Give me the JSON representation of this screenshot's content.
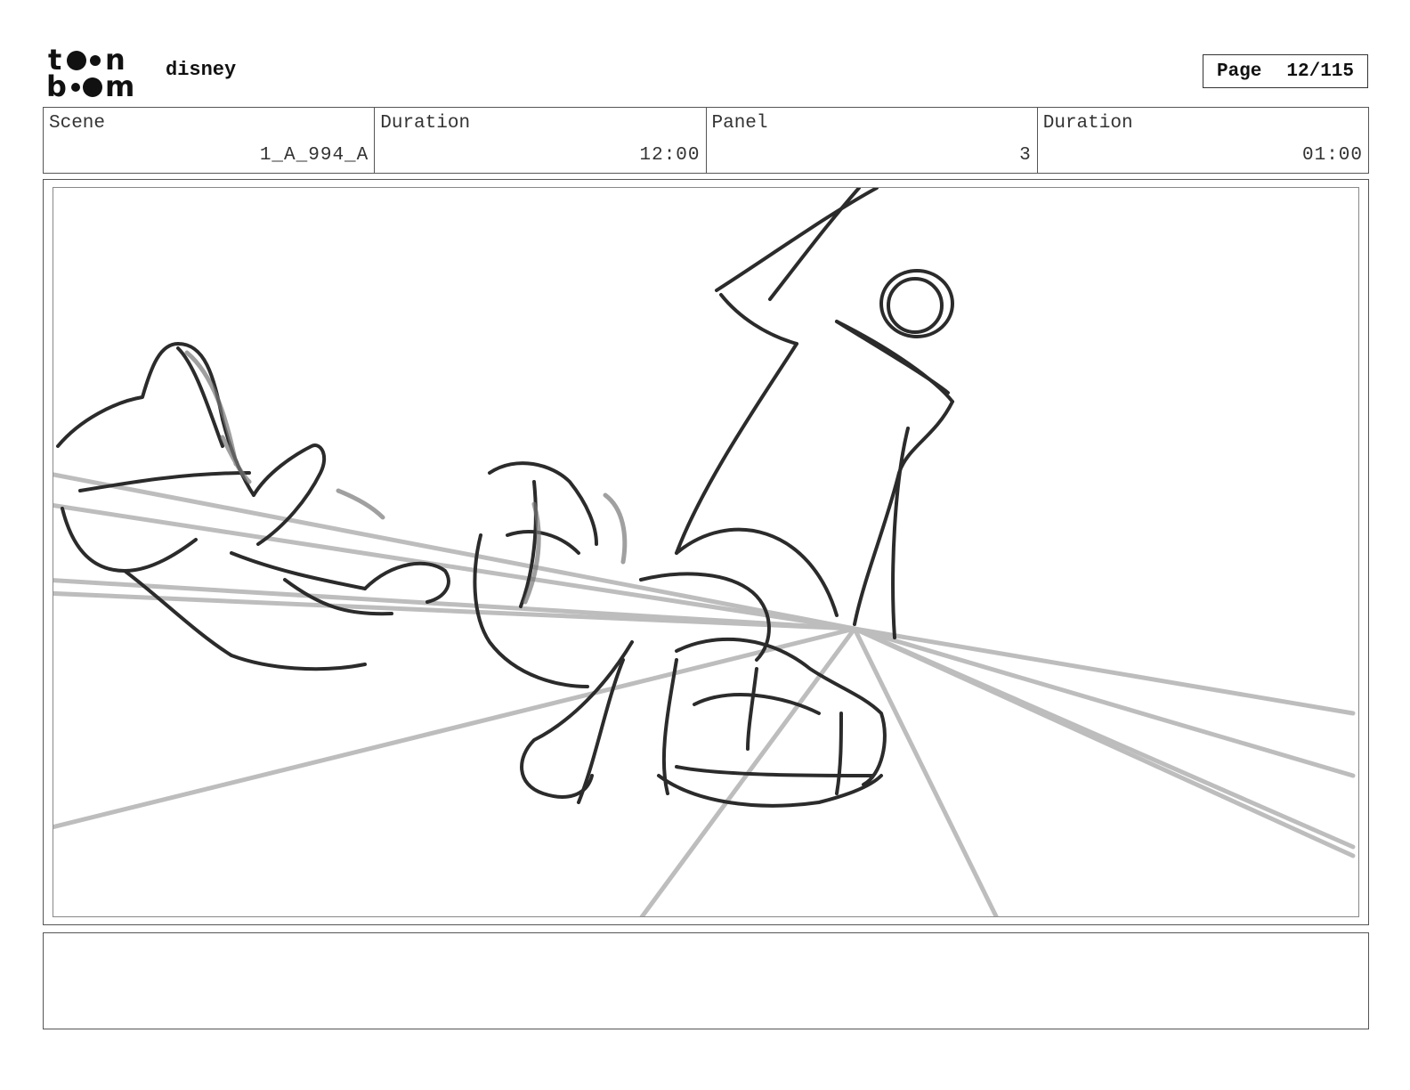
{
  "header": {
    "logo_alt": "toon boom",
    "project": "disney",
    "page_label": "Page",
    "page_value": "12/115"
  },
  "info": [
    {
      "label": "Scene",
      "value": "1_A_994_A"
    },
    {
      "label": "Duration",
      "value": "12:00"
    },
    {
      "label": "Panel",
      "value": "3"
    },
    {
      "label": "Duration",
      "value": "01:00"
    }
  ],
  "panel": {
    "content": "rough-sketch-artwork"
  },
  "caption": {
    "text": ""
  },
  "colors": {
    "sketch_line": "#2b2b2b",
    "perspective_line": "#bdbdbd",
    "frame": "#555555"
  }
}
